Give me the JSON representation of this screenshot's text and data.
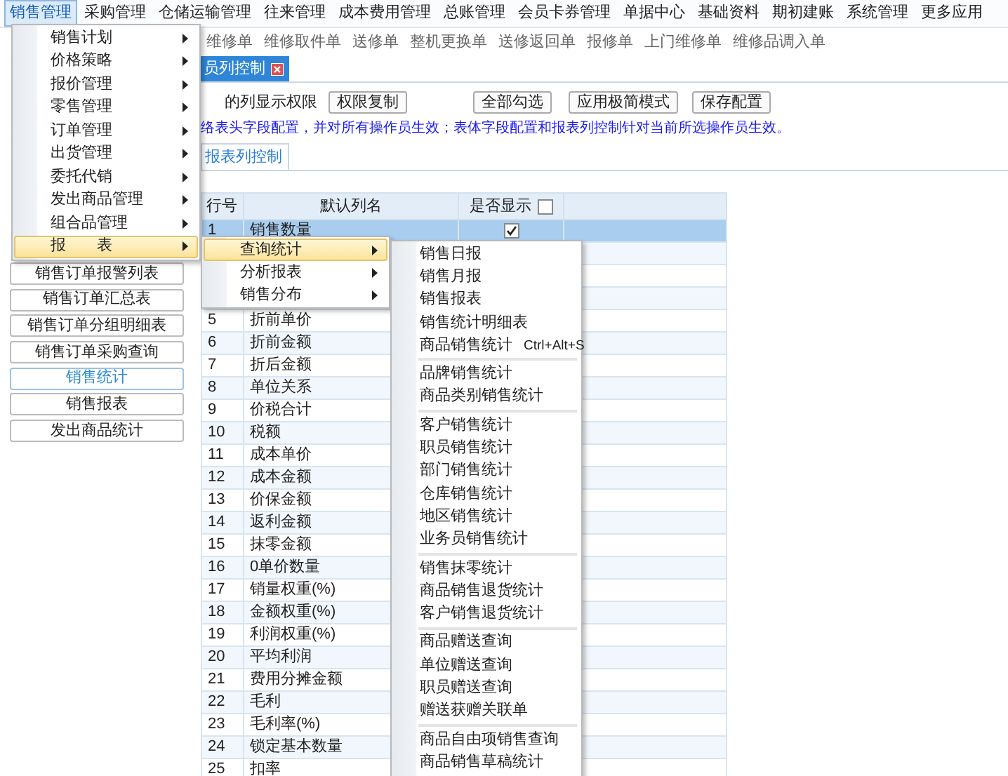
{
  "menubar": [
    {
      "label": "销售管理",
      "selected": true
    },
    {
      "label": "采购管理",
      "selected": false
    },
    {
      "label": "仓储运输管理",
      "selected": false
    },
    {
      "label": "往来管理",
      "selected": false
    },
    {
      "label": "成本费用管理",
      "selected": false
    },
    {
      "label": "总账管理",
      "selected": false
    },
    {
      "label": "会员卡券管理",
      "selected": false
    },
    {
      "label": "单据中心",
      "selected": false
    },
    {
      "label": "基础资料",
      "selected": false
    },
    {
      "label": "期初建账",
      "selected": false
    },
    {
      "label": "系统管理",
      "selected": false
    },
    {
      "label": "更多应用",
      "selected": false
    }
  ],
  "toolbar_links": [
    "维修单",
    "维修取件单",
    "送修单",
    "整机更换单",
    "送修返回单",
    "报修单",
    "上门维修单",
    "维修品调入单"
  ],
  "tab": {
    "label": "员列控制",
    "closable": true
  },
  "permission_label": "的列显示权限",
  "buttons": [
    "权限复制",
    "全部勾选",
    "应用极简模式",
    "保存配置"
  ],
  "info": "络表头字段配置，并对所有操作员生效；表体字段配置和报表列控制针对当前所选操作员生效。",
  "sub_tab": {
    "label": "报表列控制",
    "selected": true
  },
  "report_list": [
    {
      "label": "销售订单报警列表",
      "selected": false
    },
    {
      "label": "销售订单汇总表",
      "selected": false
    },
    {
      "label": "销售订单分组明细表",
      "selected": false
    },
    {
      "label": "销售订单采购查询",
      "selected": false
    },
    {
      "label": "销售统计",
      "selected": true
    },
    {
      "label": "销售报表",
      "selected": false
    },
    {
      "label": "发出商品统计",
      "selected": false
    }
  ],
  "table": {
    "columns": [
      "行号",
      "默认列名",
      "是否显示"
    ],
    "show_all_checked": false,
    "rows": [
      {
        "number": "1",
        "name": "销售数量",
        "shown": true,
        "selected": true
      },
      {
        "selected": false
      },
      {
        "selected": false
      },
      {
        "selected": false
      },
      {
        "number": "5",
        "name": "折前单价",
        "selected": false
      },
      {
        "number": "6",
        "name": "折前金额",
        "selected": false
      },
      {
        "number": "7",
        "name": "折后金额",
        "selected": false
      },
      {
        "number": "8",
        "name": "单位关系",
        "selected": false
      },
      {
        "number": "9",
        "name": "价税合计",
        "selected": false
      },
      {
        "number": "10",
        "name": "税额",
        "selected": false
      },
      {
        "number": "11",
        "name": "成本单价",
        "selected": false
      },
      {
        "number": "12",
        "name": "成本金额",
        "selected": false
      },
      {
        "number": "13",
        "name": "价保金额",
        "selected": false
      },
      {
        "number": "14",
        "name": "返利金额",
        "selected": false
      },
      {
        "number": "15",
        "name": "抹零金额",
        "selected": false
      },
      {
        "number": "16",
        "name": "0单价数量",
        "selected": false
      },
      {
        "number": "17",
        "name": "销量权重(%)",
        "selected": false
      },
      {
        "number": "18",
        "name": "金额权重(%)",
        "selected": false
      },
      {
        "number": "19",
        "name": "利润权重(%)",
        "selected": false
      },
      {
        "number": "20",
        "name": "平均利润",
        "selected": false
      },
      {
        "number": "21",
        "name": "费用分摊金额",
        "selected": false
      },
      {
        "number": "22",
        "name": "毛利",
        "selected": false
      },
      {
        "number": "23",
        "name": "毛利率(%)",
        "selected": false
      },
      {
        "number": "24",
        "name": "锁定基本数量",
        "selected": false
      },
      {
        "number": "25",
        "name": "扣率",
        "selected": false
      }
    ]
  },
  "menu": {
    "items": [
      {
        "label": "销售计划",
        "has_submenu": true,
        "selected": false
      },
      {
        "label": "价格策略",
        "has_submenu": true,
        "selected": false
      },
      {
        "label": "报价管理",
        "has_submenu": true,
        "selected": false
      },
      {
        "label": "零售管理",
        "has_submenu": true,
        "selected": false
      },
      {
        "label": "订单管理",
        "has_submenu": true,
        "selected": false
      },
      {
        "label": "出货管理",
        "has_submenu": true,
        "selected": false
      },
      {
        "label": "委托代销",
        "has_submenu": true,
        "selected": false
      },
      {
        "label": "发出商品管理",
        "has_submenu": true,
        "selected": false
      },
      {
        "label": "组合品管理",
        "has_submenu": true,
        "selected": false
      },
      {
        "label": "报　　表",
        "has_submenu": true,
        "selected": true
      }
    ]
  },
  "submenu": {
    "items": [
      {
        "label": "查询统计",
        "has_submenu": true,
        "selected": true
      },
      {
        "label": "分析报表",
        "has_submenu": true,
        "selected": false
      },
      {
        "label": "销售分布",
        "has_submenu": true,
        "selected": false
      }
    ]
  },
  "report_menu": {
    "groups": [
      [
        {
          "label": "销售日报"
        },
        {
          "label": "销售月报"
        },
        {
          "label": "销售报表"
        },
        {
          "label": "销售统计明细表"
        },
        {
          "label": "商品销售统计",
          "shortcut": "Ctrl+Alt+S"
        }
      ],
      [
        {
          "label": "品牌销售统计"
        },
        {
          "label": "商品类别销售统计"
        }
      ],
      [
        {
          "label": "客户销售统计"
        },
        {
          "label": "职员销售统计"
        },
        {
          "label": "部门销售统计"
        },
        {
          "label": "仓库销售统计"
        },
        {
          "label": "地区销售统计"
        },
        {
          "label": "业务员销售统计"
        }
      ],
      [
        {
          "label": "销售抹零统计"
        },
        {
          "label": "商品销售退货统计"
        },
        {
          "label": "客户销售退货统计"
        }
      ],
      [
        {
          "label": "商品赠送查询"
        },
        {
          "label": "单位赠送查询"
        },
        {
          "label": "职员赠送查询"
        },
        {
          "label": "赠送获赠关联单"
        }
      ],
      [
        {
          "label": "商品自由项销售查询"
        },
        {
          "label": "商品销售草稿统计"
        }
      ]
    ]
  }
}
